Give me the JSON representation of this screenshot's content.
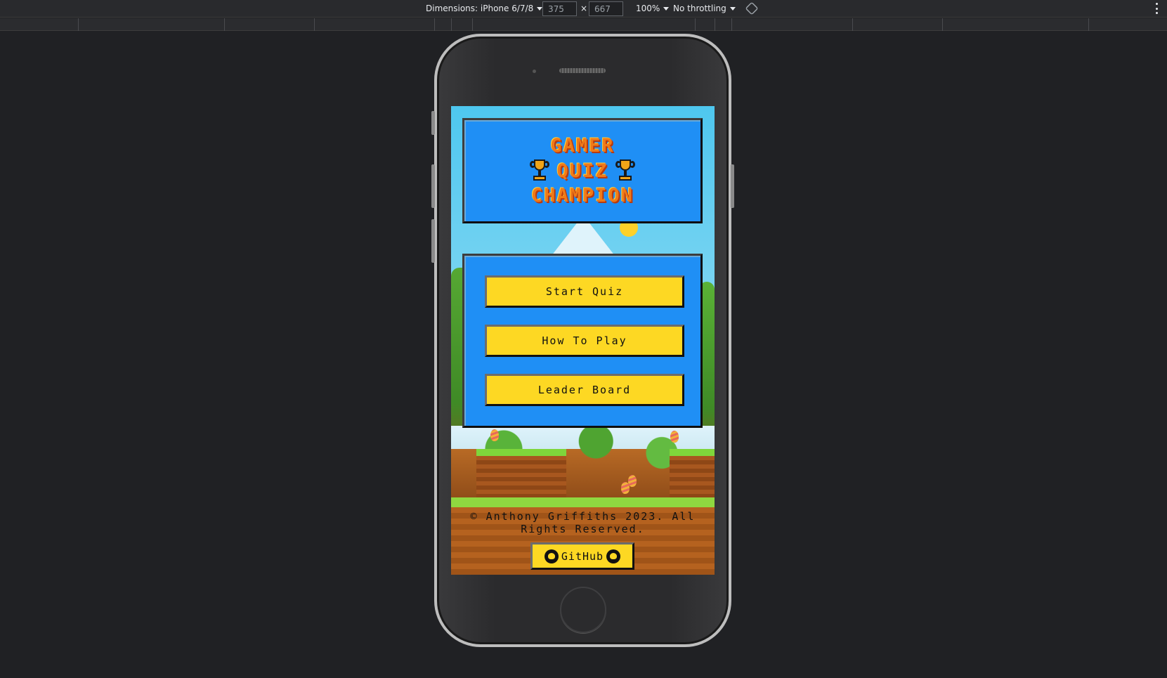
{
  "devtools": {
    "dimensions_label": "Dimensions: iPhone 6/7/8",
    "width_value": "375",
    "times": "×",
    "height_value": "667",
    "zoom": "100%",
    "throttling": "No throttling"
  },
  "app": {
    "title": {
      "line1": "GAMER",
      "line2": "QUIZ",
      "line3": "CHAMPION"
    },
    "menu": {
      "start": "Start Quiz",
      "how_to": "How To Play",
      "leaderboard": "Leader Board"
    },
    "footer": {
      "copyright": "© Anthony Griffiths 2023. All Rights Reserved.",
      "github_label": "GitHub"
    }
  },
  "colors": {
    "panel_blue": "#1f8ff5",
    "button_yellow": "#fdd823",
    "title_orange": "#f07a18",
    "page_bg": "#202124"
  }
}
